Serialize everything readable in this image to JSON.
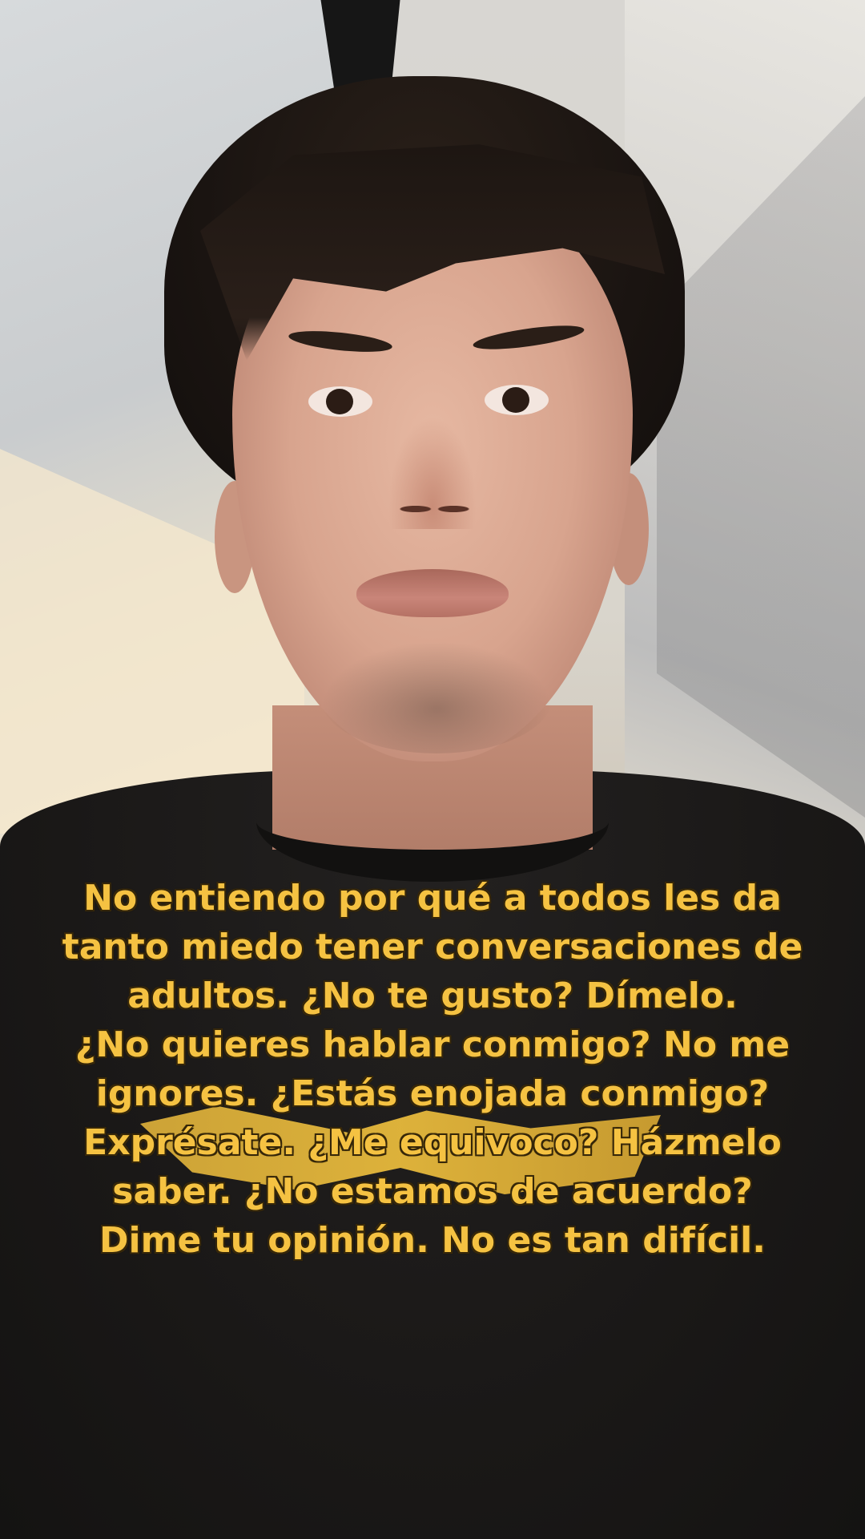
{
  "caption": {
    "lines": [
      "No entiendo por qué a todos les da",
      "tanto miedo tener conversaciones de",
      "adultos. ¿No te gusto? Dímelo.",
      "¿No quieres hablar conmigo? No me",
      "ignores. ¿Estás enojada conmigo?",
      "Exprésate. ¿Me equivoco? Házmelo",
      "saber. ¿No estamos de acuerdo?",
      "Dime tu opinión. No es tan difícil."
    ],
    "text_color": "#f5c242",
    "outline_color": "#3a2a0a"
  },
  "scene": {
    "description_icon": "person-selfie-video",
    "shirt_color": "#1a1817"
  }
}
